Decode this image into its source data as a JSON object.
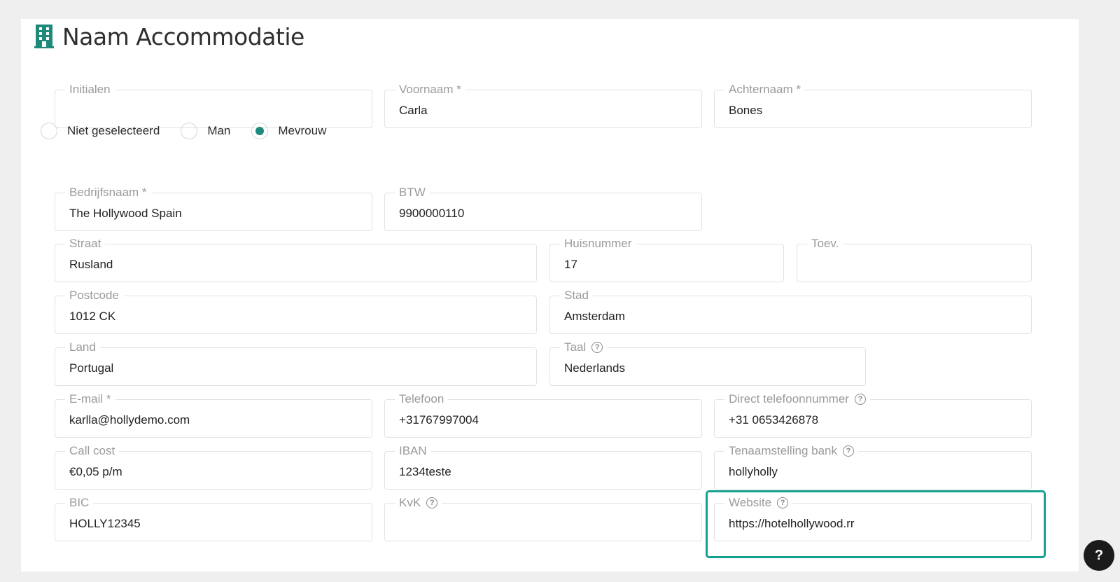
{
  "page": {
    "title": "Naam Accommodatie",
    "title_icon": "building-icon",
    "accent_color": "#1e8a7c",
    "highlight_color": "#16a091"
  },
  "fields": {
    "initialen": {
      "label": "Initialen",
      "value": ""
    },
    "voornaam": {
      "label": "Voornaam *",
      "value": "Carla"
    },
    "achternaam": {
      "label": "Achternaam *",
      "value": "Bones"
    },
    "bedrijfsnaam": {
      "label": "Bedrijfsnaam *",
      "value": "The Hollywood Spain"
    },
    "btw": {
      "label": "BTW",
      "value": "9900000110"
    },
    "straat": {
      "label": "Straat",
      "value": "Rusland"
    },
    "huisnummer": {
      "label": "Huisnummer",
      "value": "17"
    },
    "toev": {
      "label": "Toev.",
      "value": ""
    },
    "postcode": {
      "label": "Postcode",
      "value": "1012 CK"
    },
    "stad": {
      "label": "Stad",
      "value": "Amsterdam"
    },
    "land": {
      "label": "Land",
      "value": "Portugal"
    },
    "taal": {
      "label": "Taal",
      "value": "Nederlands"
    },
    "email": {
      "label": "E-mail *",
      "value": "karlla@hollydemo.com"
    },
    "telefoon": {
      "label": "Telefoon",
      "value": "+31767997004"
    },
    "direct_telefoon": {
      "label": "Direct telefoonnummer",
      "value": "+31 0653426878"
    },
    "call_cost": {
      "label": "Call cost",
      "value": "€0,05 p/m"
    },
    "iban": {
      "label": "IBAN",
      "value": "1234teste"
    },
    "tenaamstelling": {
      "label": "Tenaamstelling bank",
      "value": "hollyholly"
    },
    "bic": {
      "label": "BIC",
      "value": "HOLLY12345"
    },
    "kvk": {
      "label": "KvK",
      "value": ""
    },
    "website": {
      "label": "Website",
      "value": "https://hotelhollywood.rr"
    }
  },
  "gender": {
    "selected": "Mevrouw",
    "options": [
      "Niet geselecteerd",
      "Man",
      "Mevrouw"
    ]
  },
  "help_fab": {
    "label": "?"
  }
}
